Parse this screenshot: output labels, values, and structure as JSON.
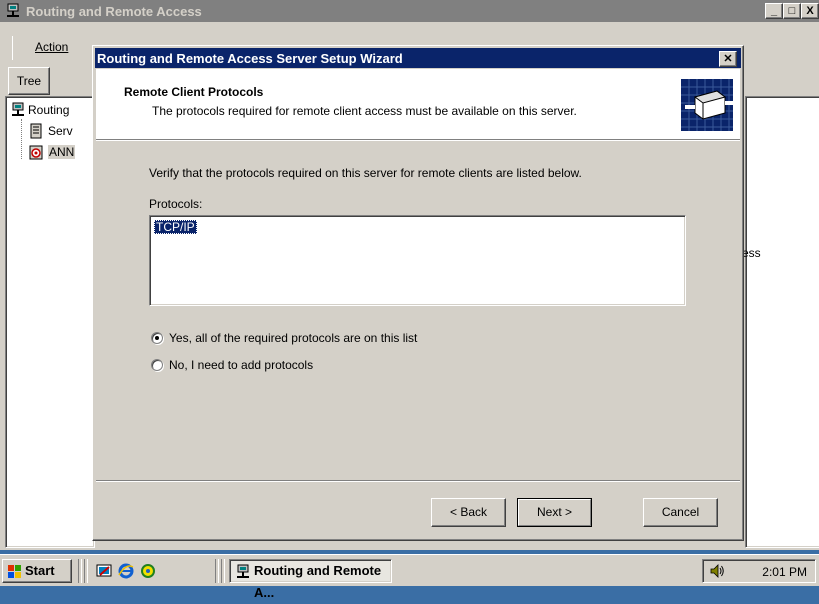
{
  "mmc": {
    "title": "Routing and Remote Access",
    "menu": {
      "action": "Action"
    },
    "tabs": {
      "tree": "Tree"
    },
    "tree": {
      "root": "Routing",
      "server_status": "Serv",
      "server": "ANN"
    },
    "right_pane_fragment": "ess",
    "caption_buttons": {
      "minimize": "_",
      "maximize": "□",
      "close": "X"
    }
  },
  "wizard": {
    "title": "Routing and Remote Access Server Setup Wizard",
    "close_glyph": "✕",
    "heading": "Remote Client Protocols",
    "subheading": "The protocols required for remote client access must be available on this server.",
    "instruction": "Verify that the protocols required on this server for remote clients are listed below.",
    "protocols_label": "Protocols:",
    "protocols": [
      "TCP/IP"
    ],
    "options": {
      "yes": {
        "label": "Yes, all of the required protocols are on this list",
        "selected": true
      },
      "no": {
        "label": "No, I need to add protocols",
        "selected": false
      }
    },
    "buttons": {
      "back": "< Back",
      "next": "Next >",
      "cancel": "Cancel"
    }
  },
  "taskbar": {
    "start": "Start",
    "task": "Routing and Remote A...",
    "clock": "2:01 PM"
  },
  "colors": {
    "desktop": "#3a6ea5",
    "face": "#d4d0c8",
    "active_title": "#0a246a",
    "inactive_title": "#808080",
    "selection": "#0a246a"
  },
  "icons": [
    "routing-icon",
    "server-icon",
    "server-status-icon",
    "network-graphic-icon",
    "windows-logo-icon",
    "desktop-icon",
    "ie-icon",
    "outlook-icon",
    "speaker-icon"
  ]
}
